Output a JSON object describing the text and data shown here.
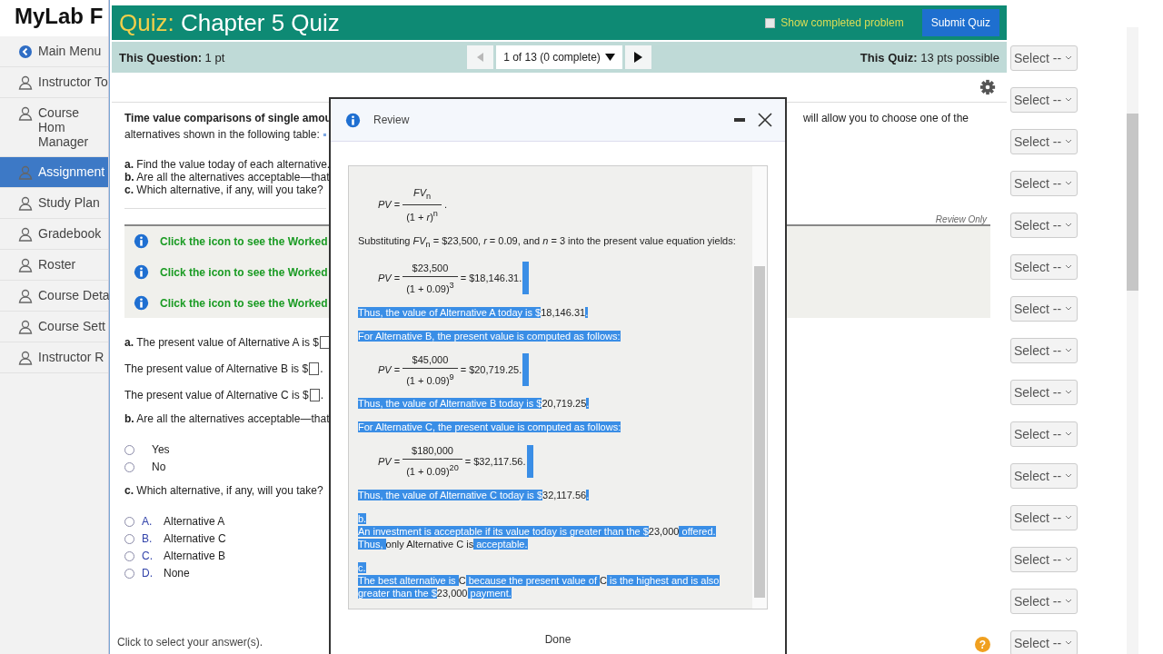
{
  "lms": {
    "title": "MyLab F",
    "menu": [
      {
        "label": "Main Menu",
        "kind": "back",
        "selected": false
      },
      {
        "label": "Instructor To",
        "kind": "tool",
        "selected": false
      },
      {
        "label": "Course Hom Manager",
        "kind": "tool",
        "selected": false
      },
      {
        "label": "Assignment",
        "kind": "tool",
        "selected": true
      },
      {
        "label": "Study Plan",
        "kind": "tool",
        "selected": false
      },
      {
        "label": "Gradebook",
        "kind": "tool",
        "selected": false
      },
      {
        "label": "Roster",
        "kind": "tool",
        "selected": false
      },
      {
        "label": "Course Deta",
        "kind": "tool",
        "selected": false
      },
      {
        "label": "Course Sett",
        "kind": "tool",
        "selected": false
      },
      {
        "label": "Instructor R",
        "kind": "tool",
        "selected": false
      }
    ],
    "dropdowns": [
      "Select --",
      "Select --",
      "Select --",
      "Select --",
      "Select --",
      "Select --",
      "Select --",
      "Select --",
      "Select --",
      "Select --",
      "Select --",
      "Select --",
      "Select --",
      "Select --",
      "Select --"
    ]
  },
  "quiz": {
    "label": "Quiz:",
    "title": "Chapter 5 Quiz",
    "show_completed": {
      "label": "Show completed problem",
      "checked": false
    },
    "submit": "Submit Quiz",
    "question_points": "**This Question:** 1 pt",
    "navigator": {
      "label": "1 of 13 (0 complete)",
      "prev_disabled": true
    },
    "quiz_points": "**This Quiz:** 13 pts possible",
    "intro": "Time value comparisons of single amou",
    "intro_line2": "alternatives shown in the following table:",
    "intro_right": "will allow you to choose one of the",
    "tasks": [
      "**a.**  Find the value today of each alternative.",
      "**b.**  Are all the alternatives acceptable—that",
      "**c.**  Which alternative, if any, will you take?"
    ],
    "review_only": "Review Only",
    "hints": [
      "Click the icon to see the Worked",
      "Click the icon to see the Worked",
      "Click the icon to see the Worked"
    ],
    "answers": [
      {
        "prompt": "**a.**  The present value of Alternative A is $"
      },
      {
        "prompt": "The present value of Alternative B is $",
        "suffix": "."
      },
      {
        "prompt": "The present value of Alternative C is $",
        "suffix": "."
      }
    ],
    "part_b": "**b.**  Are all the alternatives acceptable—that",
    "yes_no": [
      {
        "label": "Yes",
        "selected": false
      },
      {
        "label": "No",
        "selected": false
      }
    ],
    "part_c": "**c.**  Which alternative, if any, will you take?",
    "choices": [
      {
        "letter": "A.",
        "label": "Alternative A",
        "selected": false
      },
      {
        "letter": "B.",
        "label": "Alternative C",
        "selected": false
      },
      {
        "letter": "C.",
        "label": "Alternative B",
        "selected": false
      },
      {
        "letter": "D.",
        "label": "None",
        "selected": false
      }
    ],
    "footer": "Click to select your answer(s).",
    "help": "?"
  },
  "review": {
    "title": "Review",
    "done": "Done",
    "paragraphs": [
      {
        "kind": "formula",
        "lhs": "*PV* =",
        "numerator": "*FV*$_{n}$",
        "denominator": "(1 + *r*)$^{n}$",
        "result": ".",
        "selected": false
      },
      {
        "kind": "text",
        "segments": [
          {
            "text": "Substituting *FV*$_{n}$ = $23,500, *r* = 0.09, and *n* = 3 into the present value equation yields:",
            "selected": false
          }
        ]
      },
      {
        "kind": "formula",
        "lhs": "*PV* =",
        "numerator": "$23,500",
        "denominator": "(1 + 0.09)$^{3}$",
        "result": "= $18,146.31.",
        "selected": true
      },
      {
        "kind": "text",
        "segments": [
          {
            "text": "Thus, the value of Alternative A today is $",
            "selected": true
          },
          {
            "text": "18,146.31",
            "selected": false
          },
          {
            "text": ".",
            "selected": true
          }
        ]
      },
      {
        "kind": "text",
        "segments": [
          {
            "text": "For Alternative B, the present value is computed as follows:",
            "selected": true
          }
        ]
      },
      {
        "kind": "formula",
        "lhs": "*PV* =",
        "numerator": "$45,000",
        "denominator": "(1 + 0.09)$^{9}$",
        "result": "= $20,719.25.",
        "selected": true
      },
      {
        "kind": "text",
        "segments": [
          {
            "text": "Thus, the value of Alternative B today is $",
            "selected": true
          },
          {
            "text": "20,719.25",
            "selected": false
          },
          {
            "text": ".",
            "selected": true
          }
        ]
      },
      {
        "kind": "text",
        "segments": [
          {
            "text": "For Alternative C, the present value is computed as follows:",
            "selected": true
          }
        ]
      },
      {
        "kind": "formula",
        "lhs": "*PV* =",
        "numerator": "$180,000",
        "denominator": "(1 + 0.09)$^{20}$",
        "result": "= $32,117.56.",
        "selected": true
      },
      {
        "kind": "text",
        "segments": [
          {
            "text": "Thus, the value of Alternative C today is $",
            "selected": true
          },
          {
            "text": "32,117.56",
            "selected": false
          },
          {
            "text": ".",
            "selected": true
          }
        ]
      },
      {
        "kind": "label",
        "segments": [
          {
            "text": "b.",
            "selected": true
          }
        ]
      },
      {
        "kind": "text",
        "segments": [
          {
            "text": "An investment is acceptable if its value today is greater than the $",
            "selected": true
          },
          {
            "text": "23,000",
            "selected": false
          },
          {
            "text": " offered. Thus, ",
            "selected": true
          },
          {
            "text": "only Alternative C is",
            "selected": false
          },
          {
            "text": " acceptable.",
            "selected": true
          }
        ]
      },
      {
        "kind": "label",
        "segments": [
          {
            "text": "c.",
            "selected": true
          }
        ]
      },
      {
        "kind": "text",
        "segments": [
          {
            "text": "The best alternative is ",
            "selected": true
          },
          {
            "text": "C",
            "selected": false
          },
          {
            "text": " because the present value of ",
            "selected": true
          },
          {
            "text": "C",
            "selected": false
          },
          {
            "text": " is the highest and is also greater than the $",
            "selected": true
          },
          {
            "text": "23,000",
            "selected": false
          },
          {
            "text": " payment.",
            "selected": true
          }
        ]
      }
    ]
  }
}
